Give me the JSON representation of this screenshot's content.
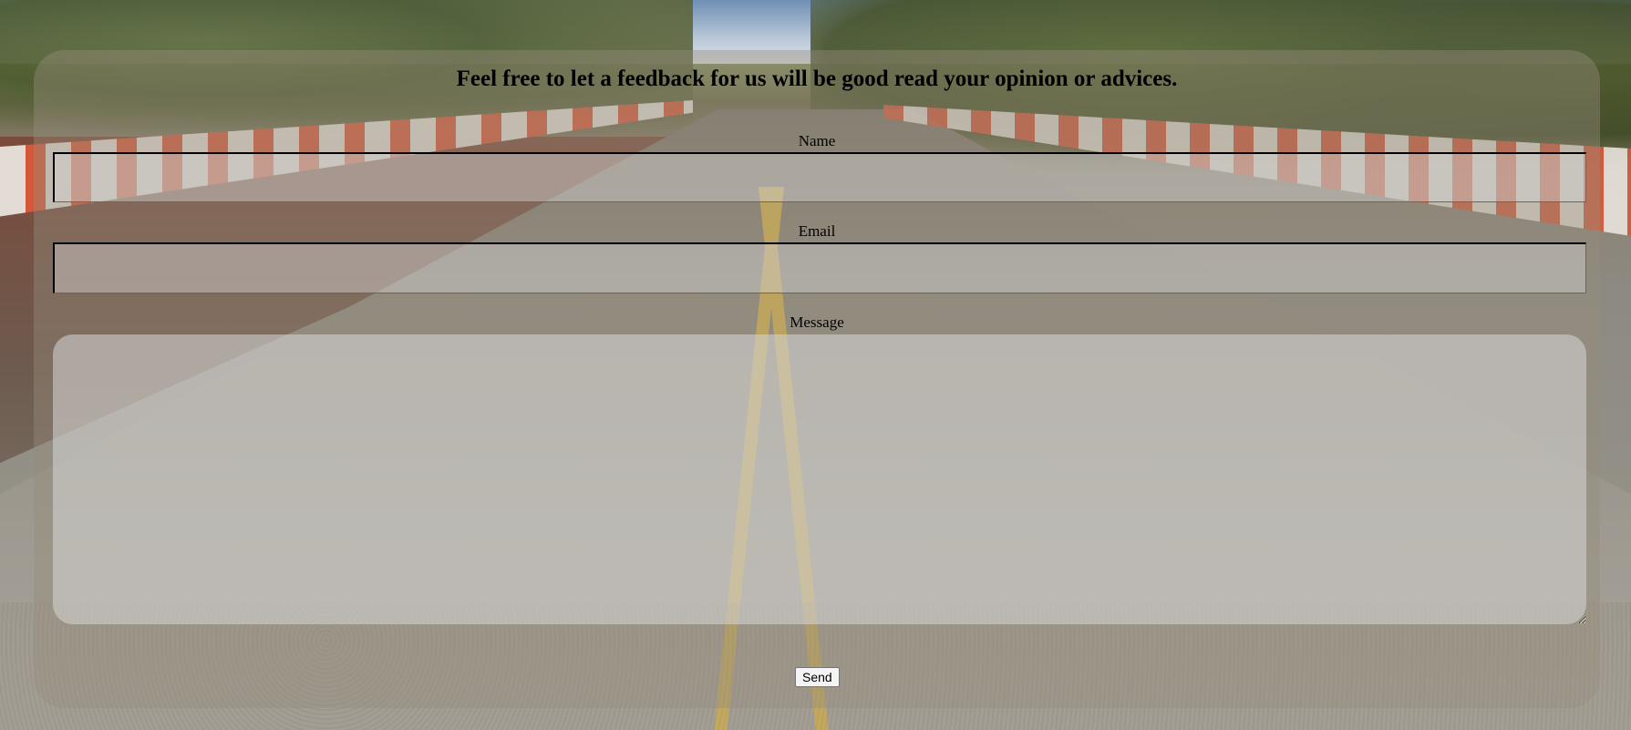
{
  "form": {
    "title": "Feel free to let a feedback for us will be good read your opinion or advices.",
    "name_label": "Name",
    "name_value": "",
    "email_label": "Email",
    "email_value": "",
    "message_label": "Message",
    "message_value": "",
    "send_label": "Send"
  },
  "background": {
    "scene": "road-with-barriers-photo"
  },
  "colors": {
    "panel": "#968c7d",
    "field": "#d2d2d2",
    "text": "#000000"
  }
}
